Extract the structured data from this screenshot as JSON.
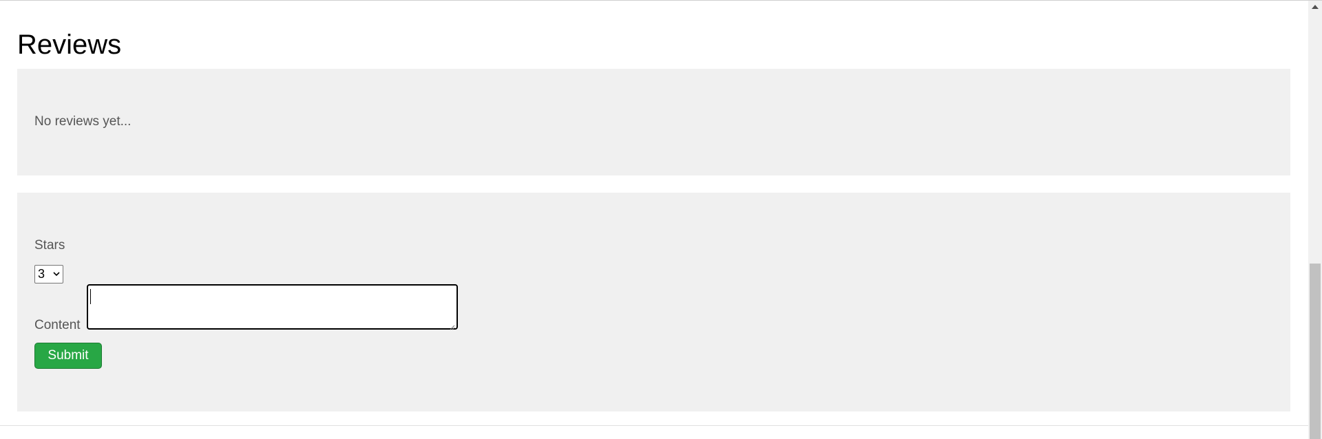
{
  "reviews": {
    "title": "Reviews",
    "empty_message": "No reviews yet..."
  },
  "form": {
    "stars_label": "Stars",
    "stars_selected": "3",
    "content_label": "Content",
    "content_value": "",
    "submit_label": "Submit"
  },
  "icons": {
    "select_arrow": "chevron-down-icon",
    "scroll_up": "arrow-up-icon"
  },
  "colors": {
    "submit_bg": "#28a745",
    "panel_bg": "#f0f0f0"
  }
}
